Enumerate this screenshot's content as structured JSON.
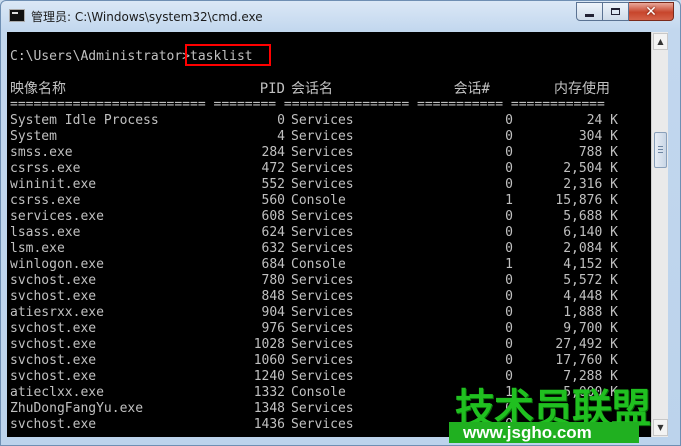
{
  "window": {
    "title": "管理员: C:\\Windows\\system32\\cmd.exe"
  },
  "console": {
    "prompt": "C:\\Users\\Administrator>",
    "command": "tasklist",
    "headers": {
      "name": "映像名称",
      "pid": "PID",
      "session_name": "会话名",
      "session_num": "会话#",
      "mem": "内存使用"
    },
    "separator": "========================= ======== ================ =========== ============",
    "rows": [
      {
        "name": "System Idle Process",
        "pid": "0",
        "session": "Services",
        "num": "0",
        "mem": "24 K"
      },
      {
        "name": "System",
        "pid": "4",
        "session": "Services",
        "num": "0",
        "mem": "304 K"
      },
      {
        "name": "smss.exe",
        "pid": "284",
        "session": "Services",
        "num": "0",
        "mem": "788 K"
      },
      {
        "name": "csrss.exe",
        "pid": "472",
        "session": "Services",
        "num": "0",
        "mem": "2,504 K"
      },
      {
        "name": "wininit.exe",
        "pid": "552",
        "session": "Services",
        "num": "0",
        "mem": "2,316 K"
      },
      {
        "name": "csrss.exe",
        "pid": "560",
        "session": "Console",
        "num": "1",
        "mem": "15,876 K"
      },
      {
        "name": "services.exe",
        "pid": "608",
        "session": "Services",
        "num": "0",
        "mem": "5,688 K"
      },
      {
        "name": "lsass.exe",
        "pid": "624",
        "session": "Services",
        "num": "0",
        "mem": "6,140 K"
      },
      {
        "name": "lsm.exe",
        "pid": "632",
        "session": "Services",
        "num": "0",
        "mem": "2,084 K"
      },
      {
        "name": "winlogon.exe",
        "pid": "684",
        "session": "Console",
        "num": "1",
        "mem": "4,152 K"
      },
      {
        "name": "svchost.exe",
        "pid": "780",
        "session": "Services",
        "num": "0",
        "mem": "5,572 K"
      },
      {
        "name": "svchost.exe",
        "pid": "848",
        "session": "Services",
        "num": "0",
        "mem": "4,448 K"
      },
      {
        "name": "atiesrxx.exe",
        "pid": "904",
        "session": "Services",
        "num": "0",
        "mem": "1,888 K"
      },
      {
        "name": "svchost.exe",
        "pid": "976",
        "session": "Services",
        "num": "0",
        "mem": "9,700 K"
      },
      {
        "name": "svchost.exe",
        "pid": "1028",
        "session": "Services",
        "num": "0",
        "mem": "27,492 K"
      },
      {
        "name": "svchost.exe",
        "pid": "1060",
        "session": "Services",
        "num": "0",
        "mem": "17,760 K"
      },
      {
        "name": "svchost.exe",
        "pid": "1240",
        "session": "Services",
        "num": "0",
        "mem": "7,288 K"
      },
      {
        "name": "atieclxx.exe",
        "pid": "1332",
        "session": "Console",
        "num": "1",
        "mem": "5,000 K"
      },
      {
        "name": "ZhuDongFangYu.exe",
        "pid": "1348",
        "session": "Services",
        "num": "0",
        "mem": ""
      },
      {
        "name": "svchost.exe",
        "pid": "1436",
        "session": "Services",
        "num": "0",
        "mem": ""
      }
    ]
  },
  "watermark": {
    "cn": "技术员联盟",
    "url": "www.jsgho.com"
  },
  "colors": {
    "console_bg": "#000000",
    "console_text": "#c0c0c0",
    "highlight": "#ff0000",
    "watermark": "#20c020"
  }
}
